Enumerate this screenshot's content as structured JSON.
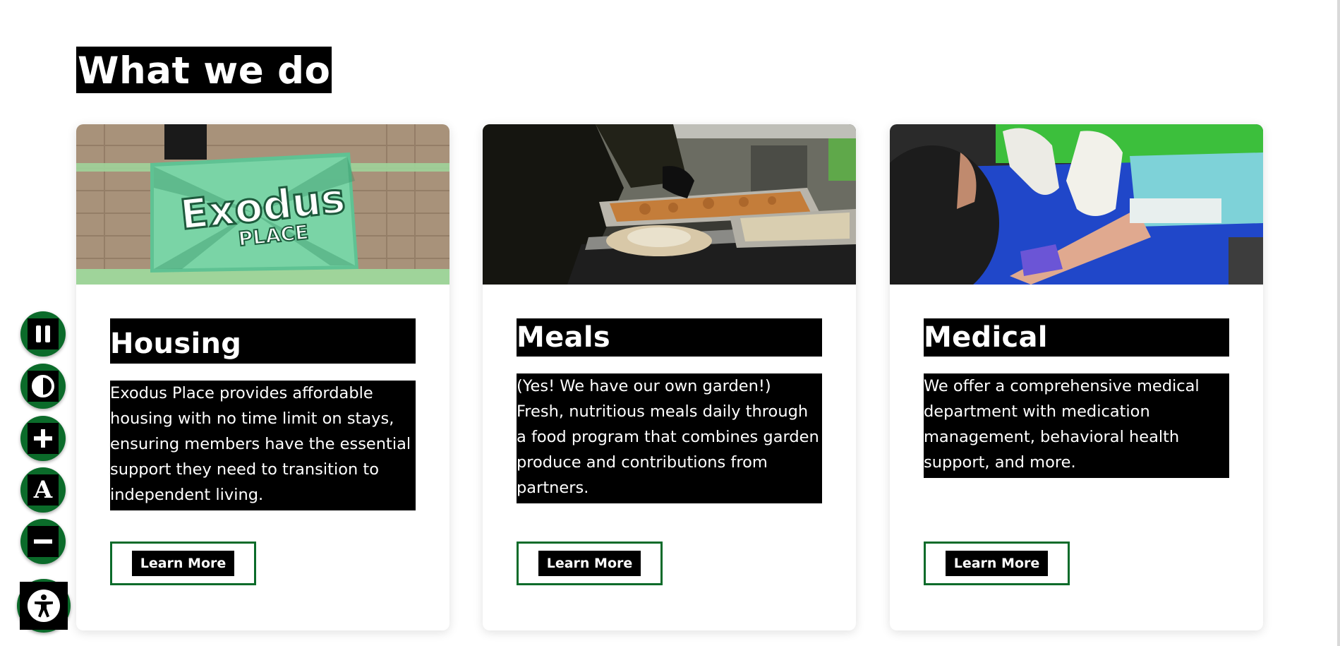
{
  "section": {
    "title": "What we do"
  },
  "cards": [
    {
      "title": "Housing",
      "text": "Exodus Place provides affordable housing with no time limit on stays, ensuring members have the essential support they need to transition to independent living.",
      "button_label": "Learn More",
      "image": {
        "icon": "building-banner-photo",
        "sign_line1": "Exodus",
        "sign_line2": "PLACE"
      }
    },
    {
      "title": "Meals",
      "text": "(Yes! We have our own garden!) Fresh, nutritious meals daily through a food program that combines garden produce and contributions from partners.",
      "button_label": "Learn More",
      "image": {
        "icon": "food-serving-photo"
      }
    },
    {
      "title": "Medical",
      "text": "We offer a comprehensive medical department with medication management, behavioral health support, and more.",
      "button_label": "Learn More",
      "image": {
        "icon": "medical-blood-draw-photo"
      }
    }
  ],
  "accessibility_toolbar": {
    "buttons": [
      {
        "name": "pause-animations",
        "icon": "pause-icon"
      },
      {
        "name": "toggle-contrast",
        "icon": "contrast-icon"
      },
      {
        "name": "increase-text",
        "icon": "plus-icon"
      },
      {
        "name": "readable-font",
        "icon": "font-letter-icon",
        "glyph": "A"
      },
      {
        "name": "decrease-text",
        "icon": "minus-icon"
      },
      {
        "name": "accessibility-menu",
        "icon": "accessibility-person-icon"
      }
    ]
  },
  "colors": {
    "accent_green": "#0b6b2a",
    "text_highlight_bg": "#000000",
    "text_highlight_fg": "#ffffff",
    "page_bg": "#ffffff"
  }
}
